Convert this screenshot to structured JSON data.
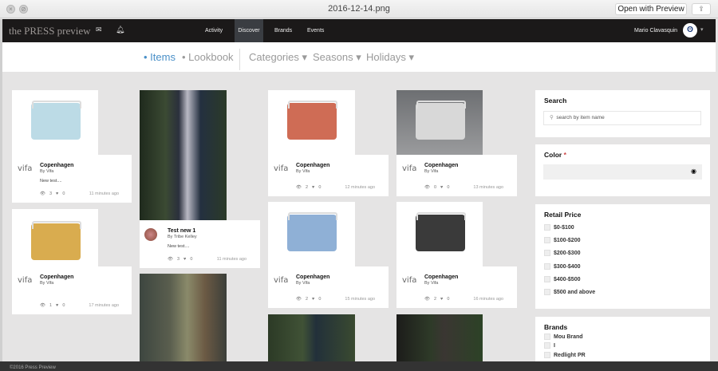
{
  "window": {
    "title": "2016-12-14.png",
    "open_with": "Open with Preview",
    "share_icon": "share-icon"
  },
  "nav": {
    "logo": "the PRESS preview",
    "links": [
      "Activity",
      "Discover",
      "Brands",
      "Events"
    ],
    "active": "Discover",
    "user": "Mario Clavasquin"
  },
  "subnav": {
    "items": "• Items",
    "lookbook": "• Lookbook",
    "categories": "Categories ▾",
    "seasons": "Seasons ▾",
    "holidays": "Holidays ▾",
    "accent": "#4a90c8"
  },
  "cards": [
    {
      "brand_logo": "vifa",
      "title": "Copenhagen",
      "by": "By Vifa",
      "desc": "New test....",
      "views": "3",
      "likes": "0",
      "time": "11 minutes ago",
      "color": "#bcdbe6"
    },
    {
      "brand_logo": "vifa",
      "title": "Copenhagen",
      "by": "By Vifa",
      "desc": "",
      "views": "1",
      "likes": "0",
      "time": "17 minutes ago",
      "color": "#d9ac4f"
    },
    {
      "title": "Test new 1",
      "by": "By Tribe Kelley",
      "desc": "New test....",
      "views": "3",
      "likes": "0",
      "time": "11 minutes ago"
    },
    {
      "brand_logo": "vifa",
      "title": "Copenhagen",
      "by": "By Vifa",
      "desc": "",
      "views": "2",
      "likes": "0",
      "time": "12 minutes ago",
      "color": "#cf6c55"
    },
    {
      "brand_logo": "vifa",
      "title": "Copenhagen",
      "by": "By Vifa",
      "desc": "",
      "views": "2",
      "likes": "0",
      "time": "15 minutes ago",
      "color": "#8fb0d6"
    },
    {
      "brand_logo": "vifa",
      "title": "Copenhagen",
      "by": "By Vifa",
      "desc": "",
      "views": "0",
      "likes": "0",
      "time": "13 minutes ago",
      "color": "#d8d8d8"
    },
    {
      "brand_logo": "vifa",
      "title": "Copenhagen",
      "by": "By Vifa",
      "desc": "",
      "views": "2",
      "likes": "0",
      "time": "16 minutes ago",
      "color": "#3a3a3a"
    }
  ],
  "sidebar": {
    "search_title": "Search",
    "search_placeholder": "search by item name",
    "color_title": "Color",
    "color_required": "*",
    "price_title": "Retail Price",
    "prices": [
      "$0-$100",
      "$100-$200",
      "$200-$300",
      "$300-$400",
      "$400-$500",
      "$500 and above"
    ],
    "brands_title": "Brands",
    "brands": [
      "Mou Brand",
      "I",
      "Redlight PR"
    ]
  },
  "footer": "©2016 Press Preview"
}
